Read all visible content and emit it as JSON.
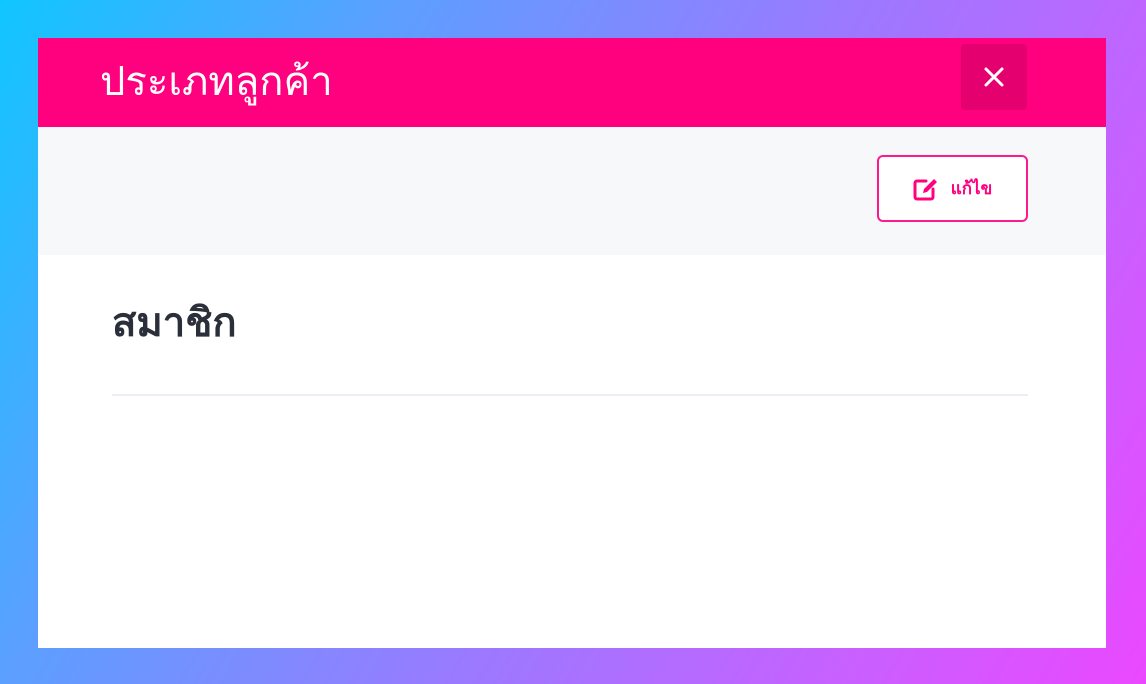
{
  "modal": {
    "title": "ประเภทลูกค้า",
    "close_icon": "close-icon"
  },
  "toolbar": {
    "edit_label": "แก้ไข",
    "edit_icon": "edit-icon"
  },
  "content": {
    "customer_type": "สมาชิก"
  },
  "colors": {
    "accent": "#ff007f",
    "close_button_bg": "#e5006f",
    "toolbar_bg": "#f7f8fa",
    "text_primary": "#2a2f3a"
  }
}
